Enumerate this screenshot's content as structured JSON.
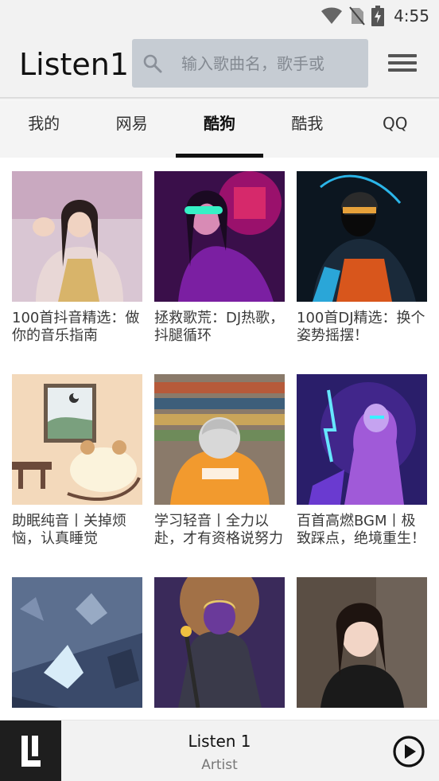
{
  "status_bar": {
    "time": "4:55",
    "icons": [
      "wifi-icon",
      "sim-off-icon",
      "battery-charging-icon"
    ]
  },
  "header": {
    "title": "Listen1",
    "search": {
      "placeholder": "输入歌曲名，歌手或",
      "value": "",
      "icon": "search-icon"
    },
    "menu_icon": "hamburger-menu-icon"
  },
  "tabs": [
    {
      "label": "我的",
      "active": false
    },
    {
      "label": "网易",
      "active": false
    },
    {
      "label": "酷狗",
      "active": true
    },
    {
      "label": "酷我",
      "active": false
    },
    {
      "label": "QQ",
      "active": false
    }
  ],
  "playlists": [
    {
      "title": "100首抖音精选：做你的音乐指南"
    },
    {
      "title": "拯救歌荒：DJ热歌，抖腿循环"
    },
    {
      "title": "100首DJ精选：换个姿势摇摆！"
    },
    {
      "title": "助眠纯音丨关掉烦恼，认真睡觉"
    },
    {
      "title": "学习轻音丨全力以赴，才有资格说努力"
    },
    {
      "title": "百首高燃BGM丨极致踩点，绝境重生！"
    },
    {
      "title": ""
    },
    {
      "title": ""
    },
    {
      "title": ""
    }
  ],
  "player": {
    "title": "Listen 1",
    "artist": "Artist",
    "logo_icon": "listen1-logo-icon",
    "play_icon": "play-circle-icon"
  },
  "colors": {
    "header_bg": "#f2f2f2",
    "search_bg": "#c6ccd3",
    "tab_indicator": "#111111",
    "player_art_bg": "#1e1e1e"
  }
}
